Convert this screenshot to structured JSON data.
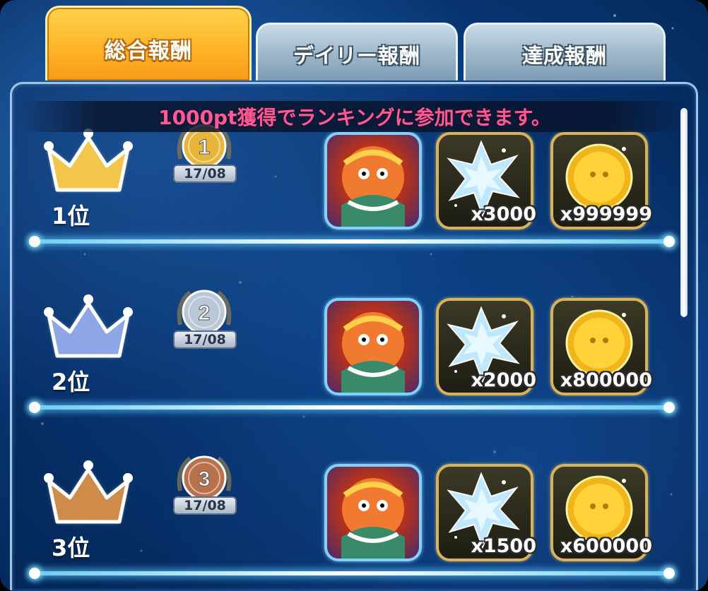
{
  "tabs": [
    {
      "label": "総合報酬",
      "active": true
    },
    {
      "label": "デイリー報酬",
      "active": false
    },
    {
      "label": "達成報酬",
      "active": false
    }
  ],
  "notice": "1000pt獲得でランキングに参加できます。",
  "ranks": [
    {
      "label": "1位",
      "medal_number": "1",
      "medal_date": "17/08",
      "crown_color": "#f3c54a",
      "medal_color": "#e8b53a",
      "rewards": [
        {
          "type": "monster-icon",
          "qty": ""
        },
        {
          "type": "gem-icon",
          "qty": "x3000"
        },
        {
          "type": "coin-icon",
          "qty": "x999999"
        }
      ]
    },
    {
      "label": "2位",
      "medal_number": "2",
      "medal_date": "17/08",
      "crown_color": "#8fa6e6",
      "medal_color": "#b9c7d6",
      "rewards": [
        {
          "type": "monster-icon",
          "qty": ""
        },
        {
          "type": "gem-icon",
          "qty": "x2000"
        },
        {
          "type": "coin-icon",
          "qty": "x800000"
        }
      ]
    },
    {
      "label": "3位",
      "medal_number": "3",
      "medal_date": "17/08",
      "crown_color": "#d08a4a",
      "medal_color": "#b8714a",
      "rewards": [
        {
          "type": "monster-icon",
          "qty": ""
        },
        {
          "type": "gem-icon",
          "qty": "x1500"
        },
        {
          "type": "coin-icon",
          "qty": "x600000"
        }
      ]
    }
  ]
}
